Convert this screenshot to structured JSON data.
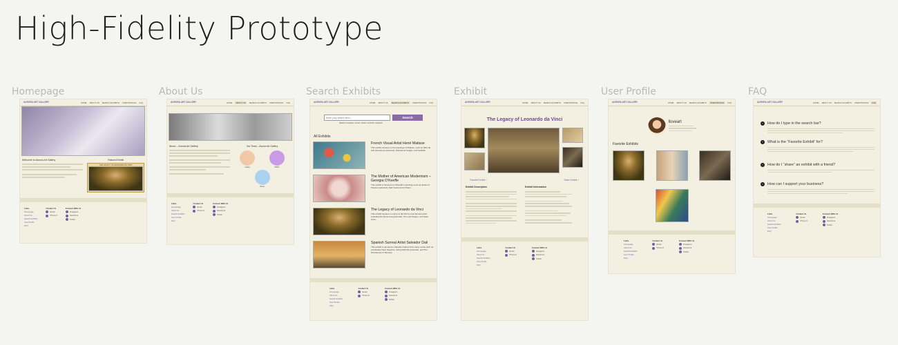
{
  "page": {
    "title": "High-Fidelity Prototype"
  },
  "frames": {
    "homepage": "Homepage",
    "about": "About Us",
    "search": "Search Exhibits",
    "exhibit": "Exhibit",
    "profile": "User Profile",
    "faq": "FAQ"
  },
  "nav": {
    "logo": "AURORA ART GALLERY",
    "links": [
      "HOME",
      "ABOUT US",
      "SEARCH EXHIBITS",
      "USER PROFILE",
      "FAQ"
    ]
  },
  "home": {
    "welcome": "Welcome to Aurora Art Gallery",
    "featured_label": "Featured Exhibit",
    "featured_title": "THE LEGACY OF LEONARDO DA VINCI"
  },
  "about": {
    "about_heading": "About – Aurora Art Gallery",
    "team_heading": "Our Team – Aurora Art Gallery",
    "team": [
      "Casey",
      "Kaitlin",
      "Sonia"
    ]
  },
  "search": {
    "placeholder": "Enter your search term...",
    "button": "Search",
    "hint": "(Search examples: sunset, vibrant, eccentric, bouquet)",
    "all_exhibits": "All Exhibits",
    "results": [
      {
        "title": "French Visual Artist Henri Matisse",
        "desc": "This exhibit focuses on the paintings of Matisse, such as Still Life with Geraniums (pictured), Window at Tangier, and Goldfish."
      },
      {
        "title": "The Mother of American Modernism –Georgia O’Keeffe",
        "desc": "This exhibit is focused on O’Keeffe’s paintings such as Series of Flowers (pictured), Red Canna and A Storm."
      },
      {
        "title": "The Legacy of Leonardo da Vinci",
        "desc": "This exhibit focuses on some of da Vinci’s most famous work including the Mona Lisa (pictured), The Last Supper, and Saint Anne."
      },
      {
        "title": "Spanish Surreal Artist Salvador Dali",
        "desc": "This exhibit is devoted to Salvador Dali and his many works such as Landscape Near Figueres, Swing Still Life (pictured), and The Persistence of Memory."
      }
    ]
  },
  "exhibit": {
    "title": "The Legacy of Leonardo da Vinci",
    "favorite": "Favorite Exhibit",
    "share": "Share Exhibit",
    "desc_heading": "Exhibit Description",
    "info_heading": "Exhibit Information"
  },
  "profile": {
    "username": "lloveart",
    "favorites_heading": "Favorite Exhibits"
  },
  "faq": {
    "questions": [
      "How do I type in the search bar?",
      "What is the “Favorite Exhibit” for?",
      "How do I “share” an exhibit with a friend?",
      "How can I support your business?"
    ]
  },
  "footer": {
    "links_h": "Links",
    "contact_h": "Contact Us",
    "connect_h": "Connect With Us",
    "links": [
      "Homepage",
      "About Us",
      "Search Exhibits",
      "User Profile",
      "FAQ"
    ],
    "contact": [
      "Email",
      "Phone #"
    ],
    "social": [
      "Instagram",
      "Facebook",
      "Twitter"
    ]
  }
}
